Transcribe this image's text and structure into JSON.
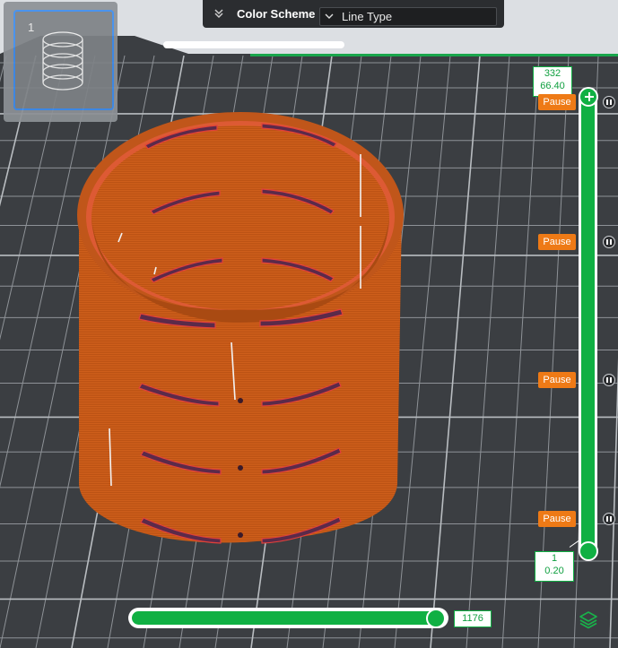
{
  "toolbar": {
    "color_scheme_label": "Color Scheme",
    "color_scheme_value": "Line Type"
  },
  "plate": {
    "thumbnail_index": "1"
  },
  "layer_slider": {
    "top_layer": "332",
    "top_height": "66.40",
    "bottom_layer": "1",
    "bottom_height": "0.20",
    "pause_label": "Pause"
  },
  "move_slider": {
    "value": "1176"
  },
  "colors": {
    "accent": "#10b043",
    "pause": "#ee7a16",
    "model": "#c85a17",
    "background": "#3a3d40"
  },
  "icons": [
    "chevrons-down-icon",
    "dropdown-chevron-icon",
    "pause-icon",
    "layers-icon",
    "add-icon"
  ]
}
